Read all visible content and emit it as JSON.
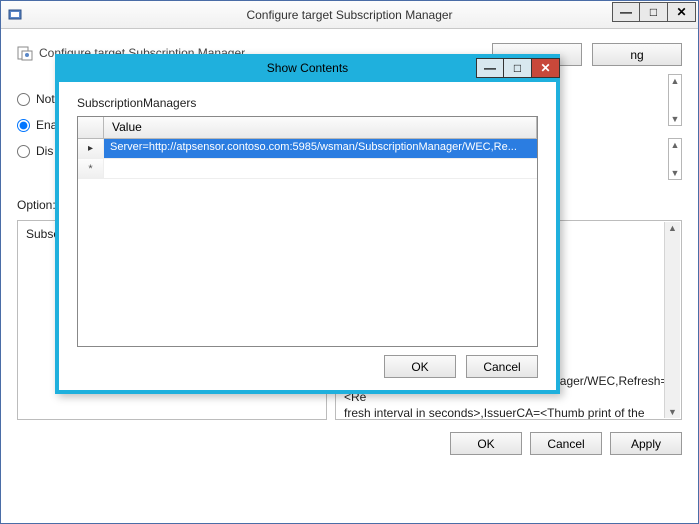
{
  "parent": {
    "title": "Configure target Subscription Manager",
    "win_controls": {
      "min": "—",
      "max": "□",
      "close": "✕"
    },
    "heading": "Configure target Subscription Manager",
    "top_buttons": {
      "mystery": " ",
      "next": "ng"
    },
    "radios": {
      "not_configured": {
        "label": "Not Configured",
        "vis": "Not"
      },
      "enabled": {
        "label": "Enabled",
        "vis": "Ena"
      },
      "disabled": {
        "label": "Disabled",
        "vis": "Dis"
      }
    },
    "options_label": "Options:",
    "options_vis": "Option:",
    "left_box_label": "SubscriptionManagers",
    "left_box_vis": "Subsc",
    "help_text": "e server address,\n/ (CA) of a target\n\nigure the Source\nqualified Domain\n specifics.\n\nPS protocol:\nServer=https://<FQDN of the\ncollector>:5986/wsman/SubscriptionManager/WEC,Refresh=<Re\nfresh interval in seconds>,IssuerCA=<Thumb print of the client\nauthentication certificate>. When using the HTTP protocol, use",
    "buttons": {
      "ok": "OK",
      "cancel": "Cancel",
      "apply": "Apply"
    }
  },
  "modal": {
    "title": "Show Contents",
    "win_controls": {
      "min": "—",
      "max": "□",
      "close": "✕"
    },
    "grid_label": "SubscriptionManagers",
    "column_header": "Value",
    "rows": [
      {
        "marker": "current",
        "value": "Server=http://atpsensor.contoso.com:5985/wsman/SubscriptionManager/WEC,Re..."
      },
      {
        "marker": "new",
        "value": ""
      }
    ],
    "new_row_glyph": "*",
    "buttons": {
      "ok": "OK",
      "cancel": "Cancel"
    }
  }
}
